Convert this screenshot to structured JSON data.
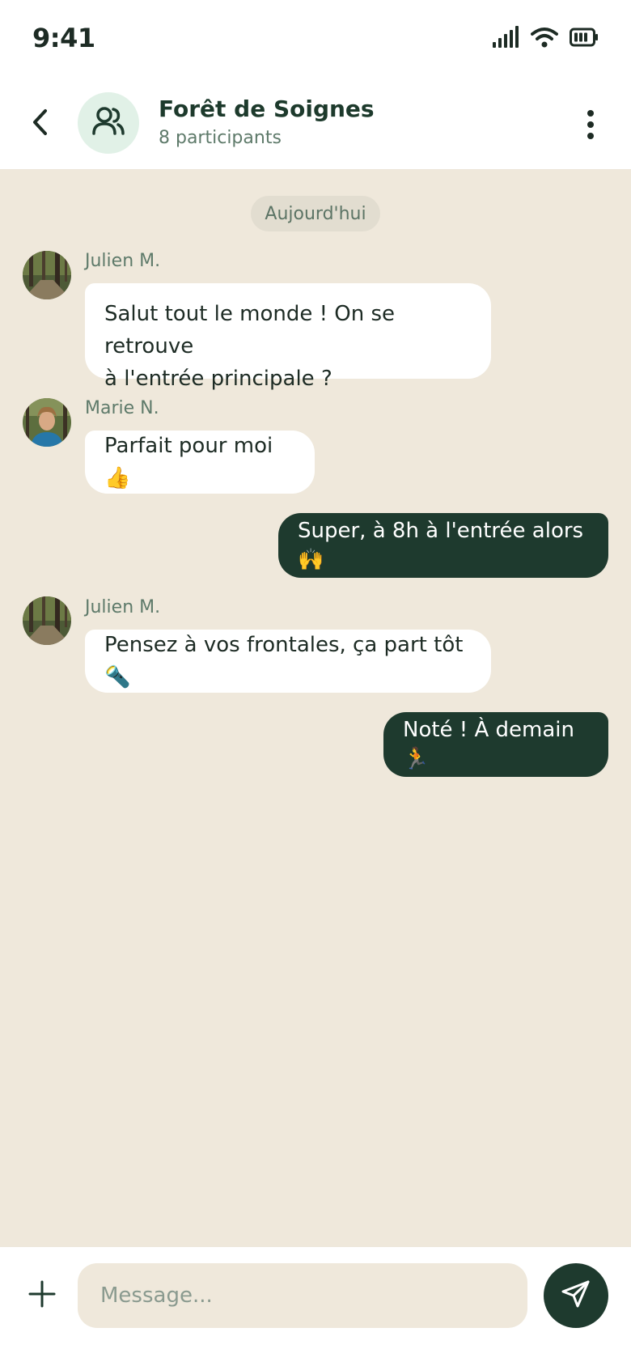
{
  "status_bar": {
    "time": "9:41"
  },
  "header": {
    "title": "Forêt de Soignes",
    "subtitle": "8 participants"
  },
  "chat": {
    "date_label": "Aujourd'hui",
    "messages": [
      {
        "sender": "Julien M.",
        "direction": "incoming",
        "line1": "Salut tout le monde ! On se retrouve",
        "line2": "à l'entrée principale ?"
      },
      {
        "sender": "Marie N.",
        "direction": "incoming",
        "text": "Parfait pour moi 👍"
      },
      {
        "direction": "outgoing",
        "text": "Super, à 8h à l'entrée alors 🙌"
      },
      {
        "sender": "Julien M.",
        "direction": "incoming",
        "text": "Pensez à vos frontales, ça part tôt 🔦"
      },
      {
        "direction": "outgoing",
        "text": "Noté ! À demain 🏃"
      }
    ]
  },
  "composer": {
    "placeholder": "Message..."
  },
  "colors": {
    "accent": "#1e3a2e",
    "chat_background": "#efe8db",
    "muted_text": "#5e7a6a"
  },
  "icons": {
    "back": "chevron-left-icon",
    "group": "users-icon",
    "more": "more-vertical-icon",
    "add": "plus-icon",
    "send": "send-icon"
  }
}
